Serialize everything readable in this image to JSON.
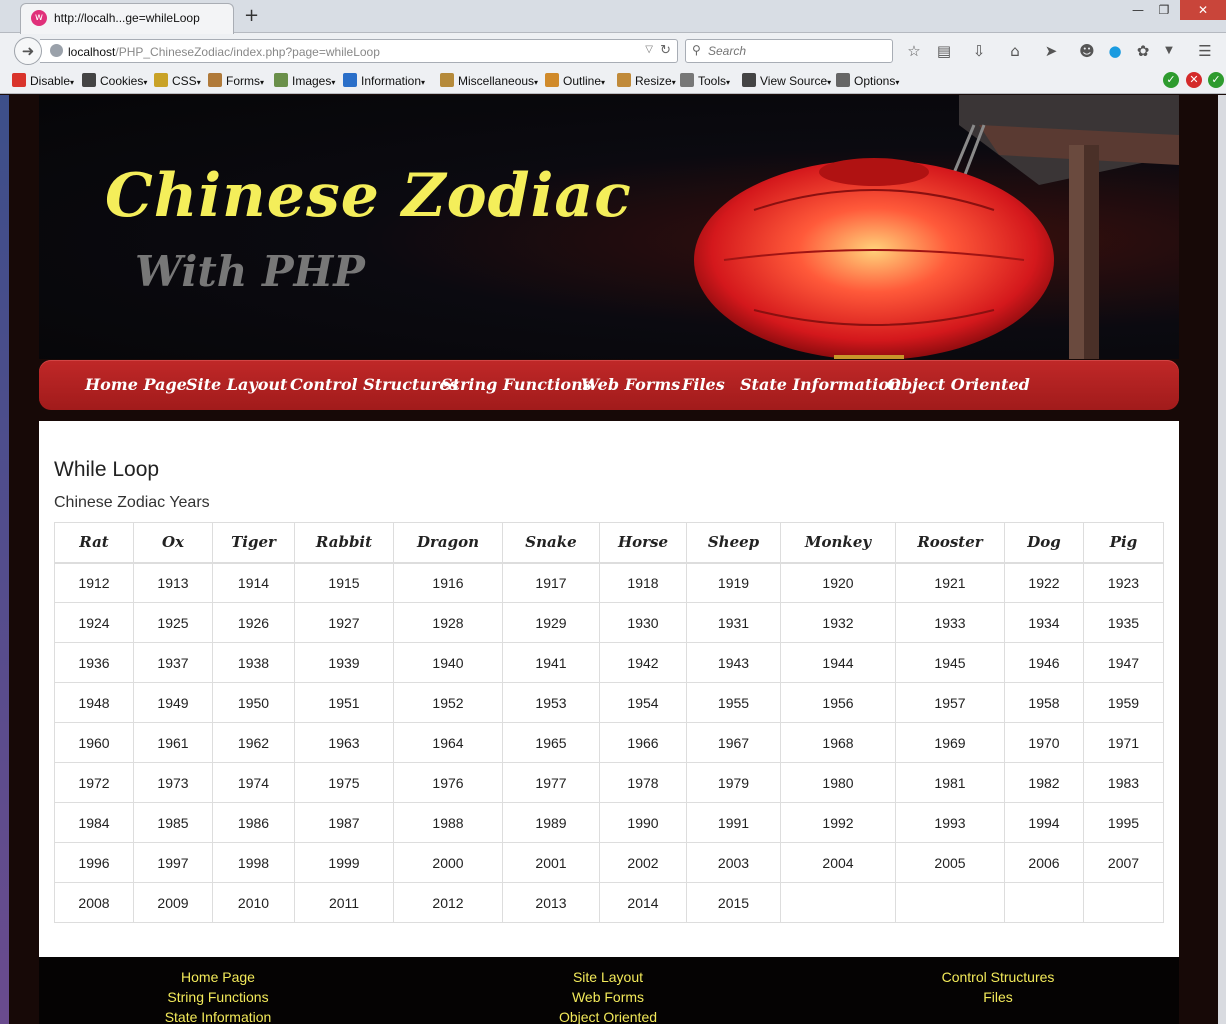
{
  "browser": {
    "tab_title": "http://localh...ge=whileLoop",
    "url_host": "localhost",
    "url_path": "/PHP_ChineseZodiac/index.php?page=whileLoop",
    "search_placeholder": "Search",
    "new_tab_glyph": "+",
    "dev_toolbar": [
      {
        "label": "Disable",
        "icon": "disable-icon",
        "color": "#d9342b"
      },
      {
        "label": "Cookies",
        "icon": "cookies-icon",
        "color": "#444444"
      },
      {
        "label": "CSS",
        "icon": "css-icon",
        "color": "#c9a227"
      },
      {
        "label": "Forms",
        "icon": "forms-icon",
        "color": "#b07a3a"
      },
      {
        "label": "Images",
        "icon": "images-icon",
        "color": "#6a8f4a"
      },
      {
        "label": "Information",
        "icon": "information-icon",
        "color": "#2a6fc9"
      },
      {
        "label": "Miscellaneous",
        "icon": "miscellaneous-icon",
        "color": "#b58a3a"
      },
      {
        "label": "Outline",
        "icon": "outline-icon",
        "color": "#d08a2a"
      },
      {
        "label": "Resize",
        "icon": "resize-icon",
        "color": "#c08a3a"
      },
      {
        "label": "Tools",
        "icon": "tools-icon",
        "color": "#777777"
      },
      {
        "label": "View Source",
        "icon": "view-source-icon",
        "color": "#444444"
      },
      {
        "label": "Options",
        "icon": "options-icon",
        "color": "#666666"
      }
    ]
  },
  "banner": {
    "title": "Chinese Zodiac",
    "subtitle": "With PHP"
  },
  "nav": [
    "Home Page",
    "Site Layout",
    "Control Structures",
    "String Functions",
    "Web Forms",
    "Files",
    "State Information",
    "Object Oriented"
  ],
  "main": {
    "heading": "While Loop",
    "subheading": "Chinese Zodiac Years",
    "table": {
      "headers": [
        "Rat",
        "Ox",
        "Tiger",
        "Rabbit",
        "Dragon",
        "Snake",
        "Horse",
        "Sheep",
        "Monkey",
        "Rooster",
        "Dog",
        "Pig"
      ],
      "rows": [
        [
          "1912",
          "1913",
          "1914",
          "1915",
          "1916",
          "1917",
          "1918",
          "1919",
          "1920",
          "1921",
          "1922",
          "1923"
        ],
        [
          "1924",
          "1925",
          "1926",
          "1927",
          "1928",
          "1929",
          "1930",
          "1931",
          "1932",
          "1933",
          "1934",
          "1935"
        ],
        [
          "1936",
          "1937",
          "1938",
          "1939",
          "1940",
          "1941",
          "1942",
          "1943",
          "1944",
          "1945",
          "1946",
          "1947"
        ],
        [
          "1948",
          "1949",
          "1950",
          "1951",
          "1952",
          "1953",
          "1954",
          "1955",
          "1956",
          "1957",
          "1958",
          "1959"
        ],
        [
          "1960",
          "1961",
          "1962",
          "1963",
          "1964",
          "1965",
          "1966",
          "1967",
          "1968",
          "1969",
          "1970",
          "1971"
        ],
        [
          "1972",
          "1973",
          "1974",
          "1975",
          "1976",
          "1977",
          "1978",
          "1979",
          "1980",
          "1981",
          "1982",
          "1983"
        ],
        [
          "1984",
          "1985",
          "1986",
          "1987",
          "1988",
          "1989",
          "1990",
          "1991",
          "1992",
          "1993",
          "1994",
          "1995"
        ],
        [
          "1996",
          "1997",
          "1998",
          "1999",
          "2000",
          "2001",
          "2002",
          "2003",
          "2004",
          "2005",
          "2006",
          "2007"
        ],
        [
          "2008",
          "2009",
          "2010",
          "2011",
          "2012",
          "2013",
          "2014",
          "2015",
          "",
          "",
          "",
          ""
        ]
      ]
    }
  },
  "footer": {
    "links": [
      "Home Page",
      "Site Layout",
      "Control Structures",
      "String Functions",
      "Web Forms",
      "Files",
      "State Information",
      "Object Oriented"
    ]
  },
  "colors": {
    "banner_title": "#f4ee5a",
    "menu_bar": "#b42020",
    "footer_link": "#f3ea5a"
  }
}
